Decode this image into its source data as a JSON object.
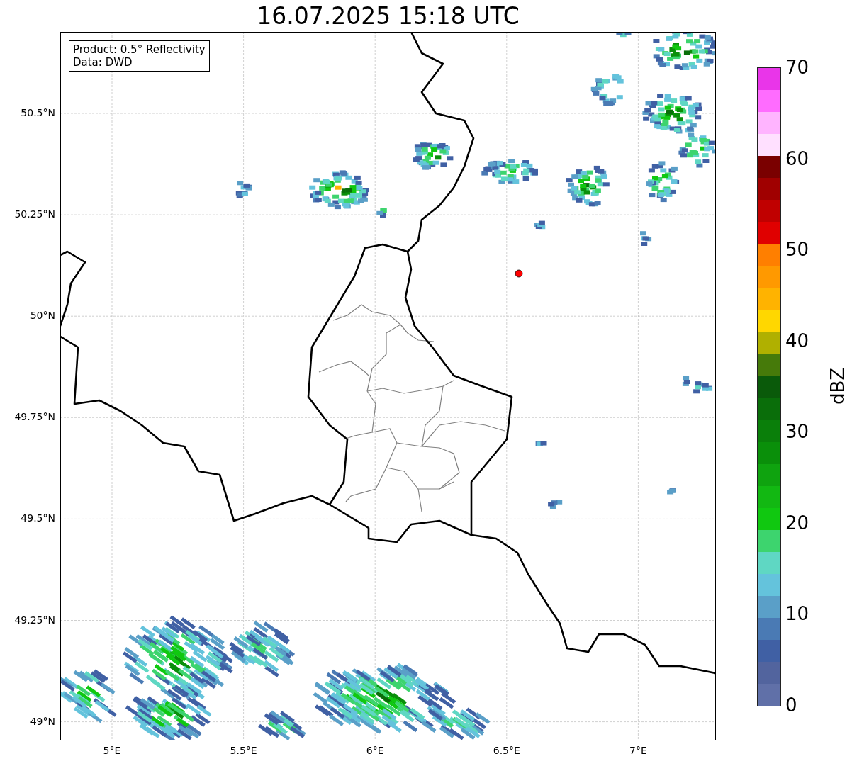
{
  "title": "16.07.2025 15:18 UTC",
  "legend": [
    "Product: 0.5° Reflectivity",
    "Data: DWD"
  ],
  "map": {
    "lat_ticks": [
      "50.5°N",
      "50.25°N",
      "50°N",
      "49.75°N",
      "49.5°N",
      "49.25°N",
      "49°N"
    ],
    "lon_ticks": [
      "5°E",
      "5.5°E",
      "6°E",
      "6.5°E",
      "7°E"
    ]
  },
  "colorbar": {
    "label": "dBZ",
    "ticks": [
      "70",
      "60",
      "50",
      "40",
      "30",
      "20",
      "10",
      "0"
    ],
    "bins": [
      {
        "color": "#6070a8"
      },
      {
        "color": "#52649e"
      },
      {
        "color": "#4060a4"
      },
      {
        "color": "#4a7ab4"
      },
      {
        "color": "#5a9fc8"
      },
      {
        "color": "#64c3dc"
      },
      {
        "color": "#5fd7c3"
      },
      {
        "color": "#3dd46e"
      },
      {
        "color": "#10c810"
      },
      {
        "color": "#12b812"
      },
      {
        "color": "#0fa30f"
      },
      {
        "color": "#0a8f0a"
      },
      {
        "color": "#0a7f0a"
      },
      {
        "color": "#0a6e0a"
      },
      {
        "color": "#0a5a0a"
      },
      {
        "color": "#467a0a"
      },
      {
        "color": "#b0b000"
      },
      {
        "color": "#ffd700"
      },
      {
        "color": "#ffb300"
      },
      {
        "color": "#ff9900"
      },
      {
        "color": "#ff7f00"
      },
      {
        "color": "#e00000"
      },
      {
        "color": "#c00000"
      },
      {
        "color": "#a00000"
      },
      {
        "color": "#7a0000"
      },
      {
        "color": "#ffe0ff"
      },
      {
        "color": "#ffb4ff"
      },
      {
        "color": "#ff6cff"
      },
      {
        "color": "#e935e9"
      }
    ]
  }
}
